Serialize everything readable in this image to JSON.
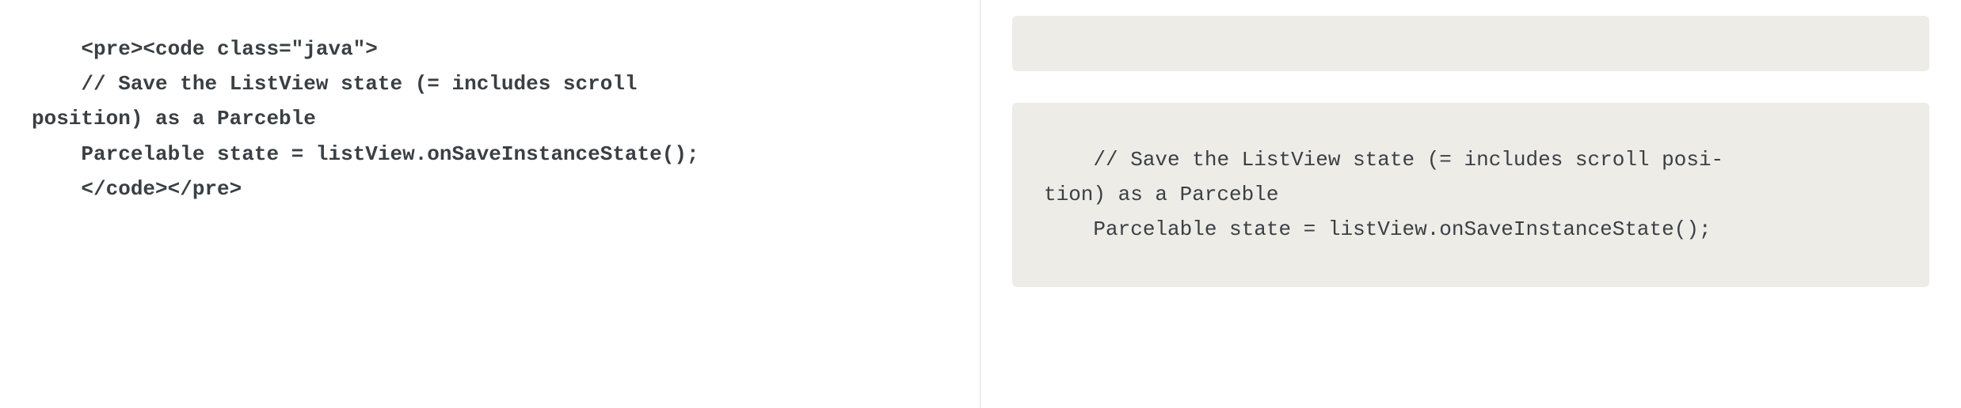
{
  "left": {
    "source": "    <pre><code class=\"java\">\n    // Save the ListView state (= includes scroll\nposition) as a Parceble\n    Parcelable state = listView.onSaveInstanceState();\n    </code></pre>"
  },
  "right": {
    "rendered": "    // Save the ListView state (= includes scroll posi-\ntion) as a Parceble\n    Parcelable state = listView.onSaveInstanceState();"
  }
}
